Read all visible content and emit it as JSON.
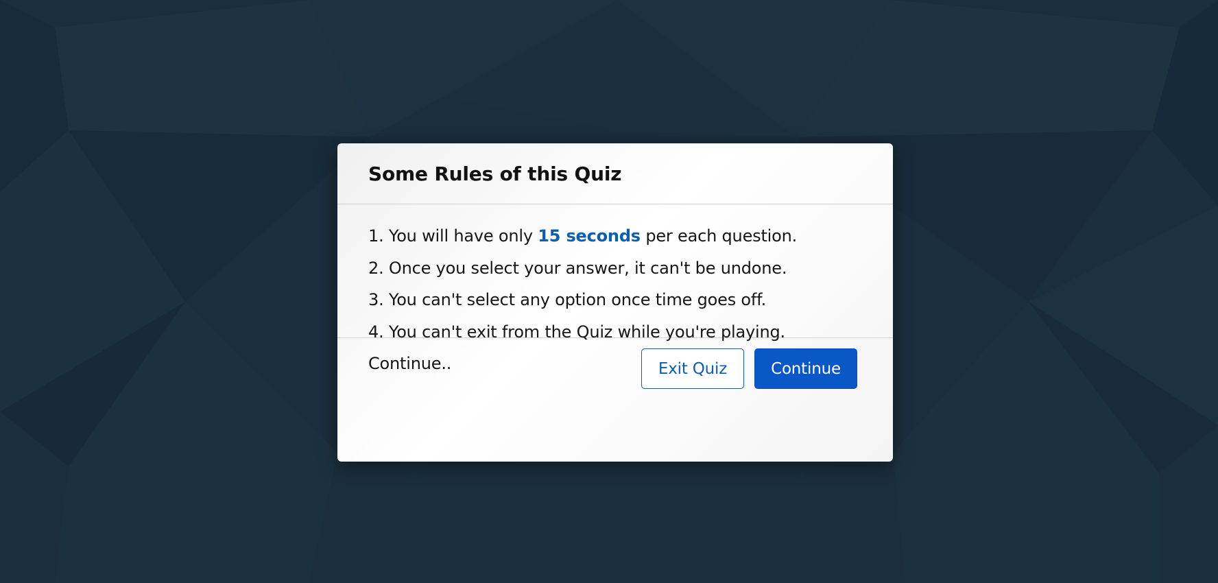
{
  "dialog": {
    "title": "Some Rules of this Quiz",
    "rules": {
      "r1_prefix": "1. You will have only ",
      "r1_highlight": "15 seconds",
      "r1_suffix": " per each question.",
      "r2": "2. Once you select your answer, it can't be undone.",
      "r3": "3. You can't select any option once time goes off.",
      "r4": "4. You can't exit from the Quiz while you're playing.",
      "r5": "Continue.."
    },
    "buttons": {
      "exit_label": "Exit Quiz",
      "continue_label": "Continue"
    }
  },
  "colors": {
    "background": "#1b2e3d",
    "accent": "#0b5fb0",
    "primary_button": "#0a57c7"
  }
}
